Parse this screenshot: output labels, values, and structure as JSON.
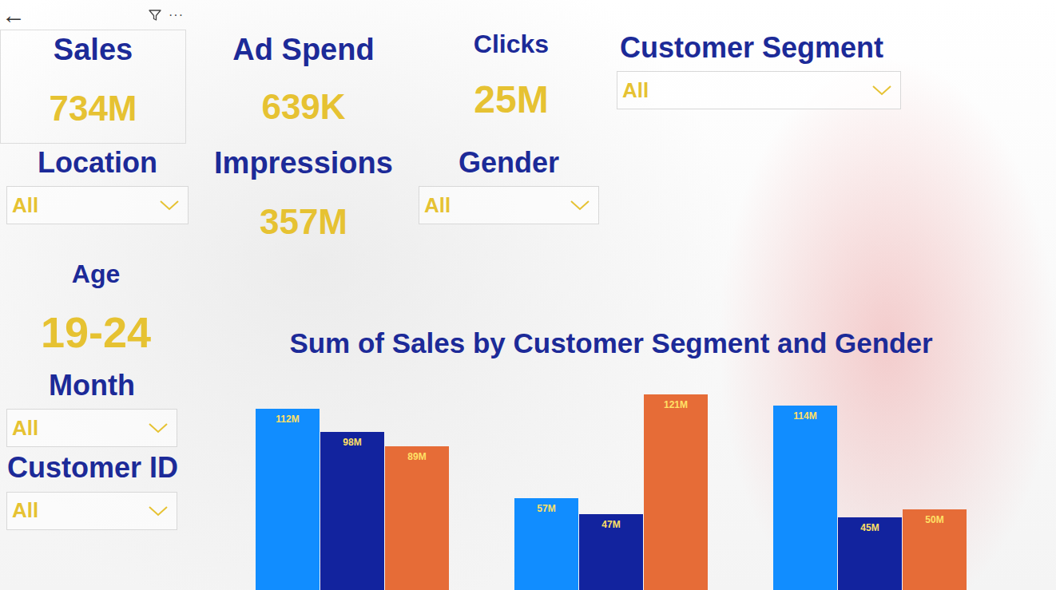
{
  "toolbar": {
    "back": "←",
    "more": "···"
  },
  "kpis": {
    "sales": {
      "title": "Sales",
      "value": "734M"
    },
    "ad_spend": {
      "title": "Ad Spend",
      "value": "639K"
    },
    "clicks": {
      "title": "Clicks",
      "value": "25M"
    },
    "impressions": {
      "title": "Impressions",
      "value": "357M"
    },
    "age": {
      "title": "Age",
      "value": "19-24"
    }
  },
  "slicers": {
    "customer_segment": {
      "title": "Customer Segment",
      "value": "All"
    },
    "location": {
      "title": "Location",
      "value": "All"
    },
    "gender": {
      "title": "Gender",
      "value": "All"
    },
    "month": {
      "title": "Month",
      "value": "All"
    },
    "customer_id": {
      "title": "Customer ID",
      "value": "All"
    }
  },
  "chart": {
    "title": "Sum of Sales by Customer Segment and Gender",
    "series": [
      {
        "color": "#118dff",
        "values": [
          112,
          57,
          114
        ],
        "labels": [
          "112M",
          "57M",
          "114M"
        ]
      },
      {
        "color": "#12239e",
        "values": [
          98,
          47,
          45
        ],
        "labels": [
          "98M",
          "47M",
          "45M"
        ]
      },
      {
        "color": "#e66c37",
        "values": [
          89,
          121,
          50
        ],
        "labels": [
          "89M",
          "121M",
          "50M"
        ]
      }
    ]
  }
}
